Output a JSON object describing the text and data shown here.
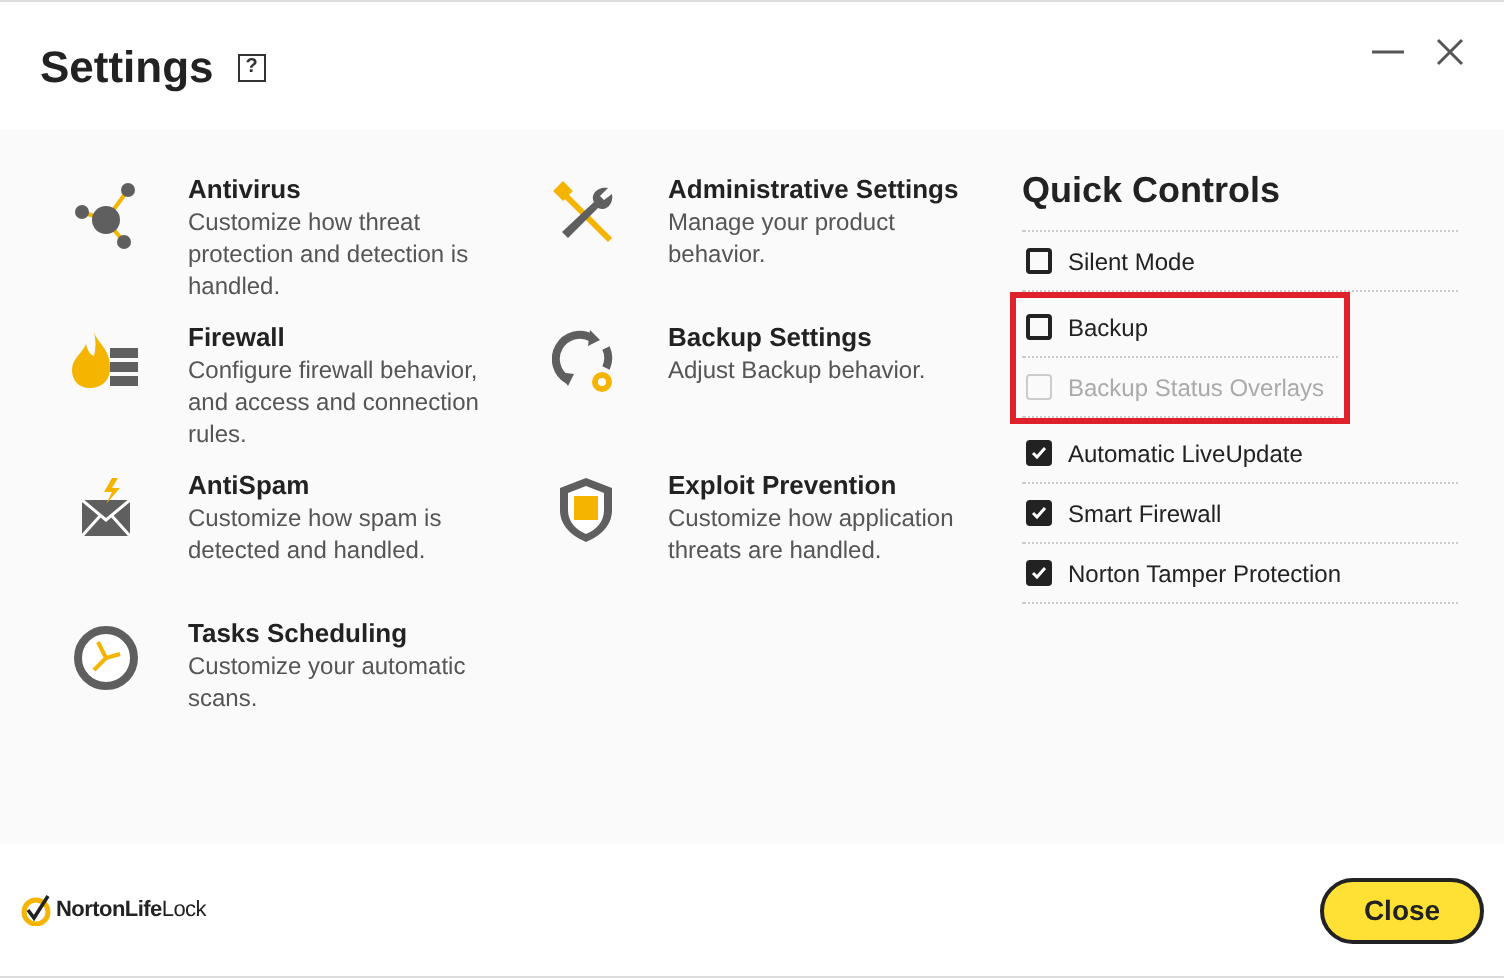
{
  "window": {
    "title": "Settings",
    "help": "?"
  },
  "settings_columns": [
    [
      {
        "kind": "antivirus",
        "title": "Antivirus",
        "description": "Customize how threat protection and detection is handled."
      },
      {
        "kind": "firewall",
        "title": "Firewall",
        "description": "Configure firewall behavior, and access and connection rules."
      },
      {
        "kind": "antispam",
        "title": "AntiSpam",
        "description": "Customize how spam is detected and handled."
      },
      {
        "kind": "scheduling",
        "title": "Tasks Scheduling",
        "description": "Customize your automatic scans."
      }
    ],
    [
      {
        "kind": "admin",
        "title": "Administrative Settings",
        "description": "Manage your product behavior."
      },
      {
        "kind": "backup",
        "title": "Backup Settings",
        "description": "Adjust Backup behavior."
      },
      {
        "kind": "exploit",
        "title": "Exploit Prevention",
        "description": "Customize how application threats are handled."
      }
    ]
  ],
  "quick_controls": {
    "title": "Quick Controls",
    "items": [
      {
        "label": "Silent Mode",
        "checked": false,
        "disabled": false,
        "highlighted": false
      },
      {
        "label": "Backup",
        "checked": false,
        "disabled": false,
        "highlighted": true
      },
      {
        "label": "Backup Status Overlays",
        "checked": false,
        "disabled": true,
        "highlighted": true
      },
      {
        "label": "Automatic LiveUpdate",
        "checked": true,
        "disabled": false,
        "highlighted": false
      },
      {
        "label": "Smart Firewall",
        "checked": true,
        "disabled": false,
        "highlighted": false
      },
      {
        "label": "Norton Tamper Protection",
        "checked": true,
        "disabled": false,
        "highlighted": false
      }
    ]
  },
  "footer": {
    "logo": "**NortonLife**Lock",
    "close_button": "Close"
  }
}
